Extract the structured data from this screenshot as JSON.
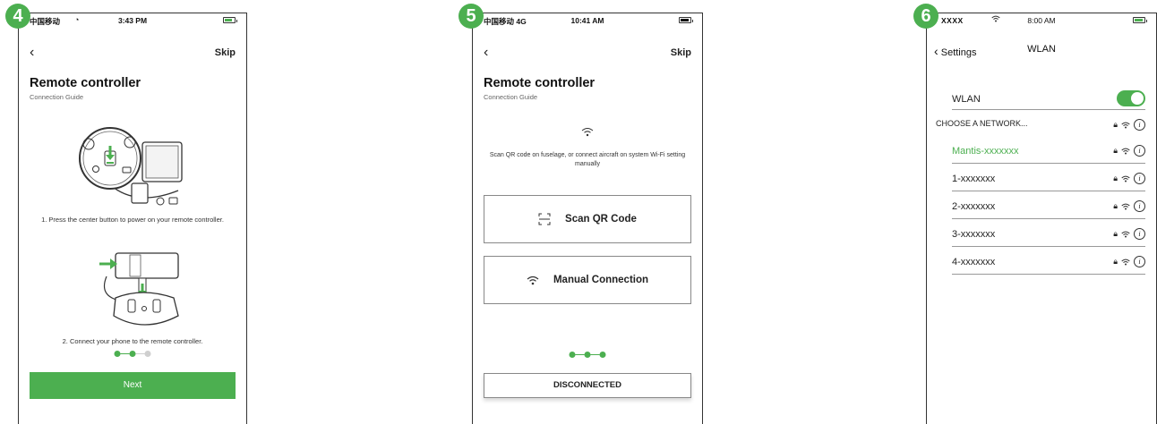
{
  "accent_color": "#4caf50",
  "badges": {
    "step4": "4",
    "step5": "5",
    "step6": "6"
  },
  "screen4": {
    "status": {
      "carrier": "中国移动",
      "time": "3:43 PM"
    },
    "skip_label": "Skip",
    "title": "Remote controller",
    "subtitle": "Connection Guide",
    "instruction_1": "1. Press the center button to power on your remote controller.",
    "instruction_2": "2. Connect your phone to the remote controller.",
    "progress_step": 2,
    "next_label": "Next"
  },
  "screen5": {
    "status": {
      "carrier": "中国移动  4G",
      "time": "10:41 AM"
    },
    "skip_label": "Skip",
    "title": "Remote controller",
    "subtitle": "Connection Guide",
    "instruction": "Scan QR code on fuselage, or connect aircraft on system Wi-Fi setting manually",
    "scan_label": "Scan QR Code",
    "manual_label": "Manual Connection",
    "progress_step": 3,
    "disconnected_label": "DISCONNECTED"
  },
  "screen6": {
    "status": {
      "carrier": "XXXX",
      "time": "8:00 AM"
    },
    "back_label": "Settings",
    "nav_title": "WLAN",
    "wlan_label": "WLAN",
    "wlan_on": true,
    "choose_label": "CHOOSE A NETWORK...",
    "networks": [
      {
        "name": "Mantis-xxxxxxx"
      },
      {
        "name": "1-xxxxxxx"
      },
      {
        "name": "2-xxxxxxx"
      },
      {
        "name": "3-xxxxxxx"
      },
      {
        "name": "4-xxxxxxx"
      }
    ]
  }
}
